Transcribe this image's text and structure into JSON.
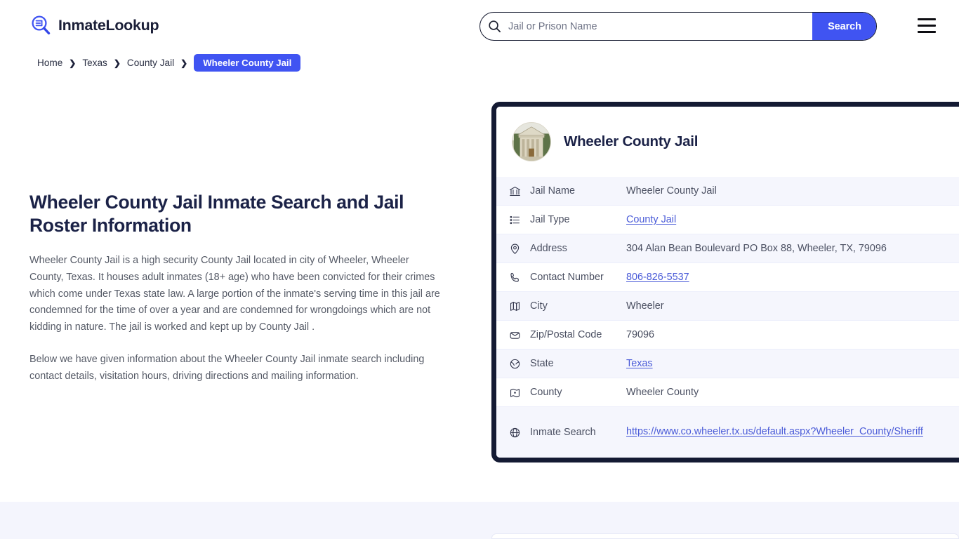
{
  "header": {
    "brand_name": "InmateLookup",
    "brand_icon": "magnifier-list-logo-icon",
    "search": {
      "icon": "search-icon",
      "placeholder": "Jail or Prison Name",
      "value": "",
      "button_label": "Search"
    },
    "menu_icon": "hamburger-menu-icon"
  },
  "breadcrumb": {
    "separator": "❯",
    "items": [
      {
        "label": "Home",
        "current": false
      },
      {
        "label": "Texas",
        "current": false
      },
      {
        "label": "County Jail",
        "current": false
      },
      {
        "label": "Wheeler County Jail",
        "current": true
      }
    ]
  },
  "main": {
    "title": "Wheeler County Jail Inmate Search and Jail Roster Information",
    "paragraph_1": "Wheeler County Jail is a high security County Jail located in city of Wheeler, Wheeler County, Texas. It houses adult inmates (18+ age) who have been convicted for their crimes which come under Texas state law. A large portion of the inmate's serving time in this jail are condemned for the time of over a year and are condemned for wrongdoings which are not kidding in nature. The jail is worked and kept up by County Jail .",
    "paragraph_2": "Below we have given information about the Wheeler County Jail inmate search including contact details, visitation hours, driving directions and mailing information."
  },
  "info_card": {
    "avatar_icon": "courthouse-photo-avatar",
    "title": "Wheeler County Jail",
    "rows": [
      {
        "icon": "bank-icon",
        "label": "Jail Name",
        "value": "Wheeler County Jail",
        "link": false
      },
      {
        "icon": "list-icon",
        "label": "Jail Type",
        "value": "County Jail",
        "link": true
      },
      {
        "icon": "map-pin-icon",
        "label": "Address",
        "value": "304 Alan Bean Boulevard PO Box 88, Wheeler, TX, 79096",
        "link": false
      },
      {
        "icon": "phone-icon",
        "label": "Contact Number",
        "value": "806-826-5537",
        "link": true
      },
      {
        "icon": "map-icon",
        "label": "City",
        "value": "Wheeler",
        "link": false
      },
      {
        "icon": "envelope-icon",
        "label": "Zip/Postal Code",
        "value": "79096",
        "link": false
      },
      {
        "icon": "globe-grid-icon",
        "label": "State",
        "value": "Texas",
        "link": true
      },
      {
        "icon": "county-map-icon",
        "label": "County",
        "value": "Wheeler County",
        "link": false
      },
      {
        "icon": "globe-icon",
        "label": "Inmate Search",
        "value": "https://www.co.wheeler.tx.us/default.aspx?Wheeler_County/Sheriff",
        "link": true
      }
    ]
  },
  "colors": {
    "accent": "#4054f2",
    "card_border": "#141a33",
    "link": "#4a5bd8",
    "heading": "#1b2247",
    "row_alt": "#f5f6fd",
    "band": "#f4f5fd"
  }
}
